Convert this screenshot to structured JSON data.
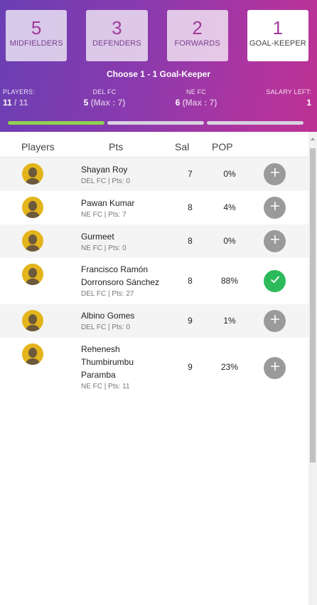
{
  "tabs": [
    {
      "count": "5",
      "label": "MIDFIELDERS",
      "active": false
    },
    {
      "count": "3",
      "label": "DEFENDERS",
      "active": false
    },
    {
      "count": "2",
      "label": "FORWARDS",
      "active": false
    },
    {
      "count": "1",
      "label": "GOAL-KEEPER",
      "active": true
    }
  ],
  "instruction": "Choose 1 - 1 Goal-Keeper",
  "stats": {
    "players": {
      "title": "PLAYERS:",
      "value": "11",
      "max": "/ 11"
    },
    "team1": {
      "title": "DEL FC",
      "value": "5",
      "max": "(Max : 7)"
    },
    "team2": {
      "title": "NE FC",
      "value": "6",
      "max": "(Max : 7)"
    },
    "salary": {
      "title": "SALARY LEFT:",
      "value": "1"
    }
  },
  "progress": [
    1,
    0,
    0
  ],
  "columns": {
    "players": "Players",
    "pts": "Pts",
    "sal": "Sal",
    "pop": "POP"
  },
  "players": [
    {
      "name": "Shayan Roy",
      "sub": "DEL FC | Pts: 0",
      "sal": "7",
      "pop": "0%",
      "added": false
    },
    {
      "name": "Pawan Kumar",
      "sub": "NE FC | Pts: 7",
      "sal": "8",
      "pop": "4%",
      "added": false
    },
    {
      "name": "Gurmeet",
      "sub": "NE FC | Pts: 0",
      "sal": "8",
      "pop": "0%",
      "added": false
    },
    {
      "name": "Francisco Ramón Dorronsoro Sánchez",
      "sub": "DEL FC | Pts: 27",
      "sal": "8",
      "pop": "88%",
      "added": true
    },
    {
      "name": "Albino Gomes",
      "sub": "DEL FC | Pts: 0",
      "sal": "9",
      "pop": "1%",
      "added": false
    },
    {
      "name": "Rehenesh Thumbirumbu Paramba",
      "sub": "NE FC | Pts: 11",
      "sal": "9",
      "pop": "23%",
      "added": false
    }
  ],
  "colors": {
    "accent": "#a03a9b",
    "progress_done": "#8fd14f",
    "added": "#2dba5a",
    "avatar": "#e3b41b"
  }
}
